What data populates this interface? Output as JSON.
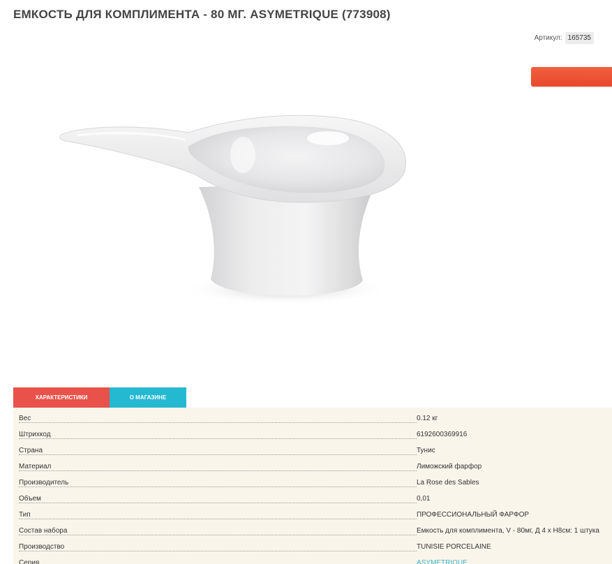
{
  "product": {
    "title": "ЕМКОСТЬ ДЛЯ КОМПЛИМЕНТА - 80 МГ. ASYMETRIQUE (773908)",
    "sku_label": "Артикул:",
    "sku_value": "165735",
    "image_name": "white-porcelain-compliment-dish"
  },
  "colors": {
    "cart_button": "#e9482b",
    "tab_specs": "#e8524a",
    "tab_store": "#25b9d1",
    "panel_bg": "#faf5eb",
    "link": "#3bb5c9"
  },
  "tabs": [
    {
      "label": "ХАРАКТЕРИСТИКИ",
      "active": true
    },
    {
      "label": "О МАГАЗИНЕ",
      "active": false
    }
  ],
  "specs": [
    {
      "name": "Вес",
      "value": "0.12 кг"
    },
    {
      "name": "Штрихкод",
      "value": "6192600369916"
    },
    {
      "name": "Страна",
      "value": "Тунис"
    },
    {
      "name": "Материал",
      "value": "Лиможский фарфор"
    },
    {
      "name": "Производитель",
      "value": "La Rose des Sables"
    },
    {
      "name": "Объем",
      "value": "0,01"
    },
    {
      "name": "Тип",
      "value": "ПРОФЕССИОНАЛЬНЫЙ ФАРФОР"
    },
    {
      "name": "Состав набора",
      "value": "Емкость для комплимента, V - 80мг, Д 4 x H8см: 1 штука"
    },
    {
      "name": "Производство",
      "value": "TUNISIE PORCELAINE"
    },
    {
      "name": "Серия",
      "value": "ASYMETRIQUE",
      "link": true
    }
  ]
}
